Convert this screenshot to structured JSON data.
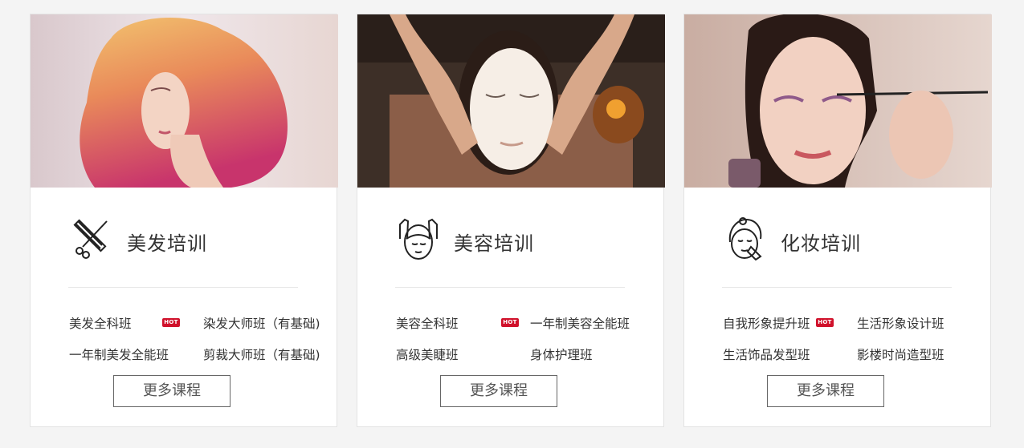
{
  "cards": [
    {
      "title": "美发培训",
      "icon": "scissors-comb-icon",
      "courses": [
        "美发全科班",
        "染发大师班（有基础)",
        "一年制美发全能班",
        "剪裁大师班（有基础)"
      ],
      "hot_badge": "HOT",
      "more_label": "更多课程"
    },
    {
      "title": "美容培训",
      "icon": "face-massage-icon",
      "courses": [
        "美容全科班",
        "一年制美容全能班",
        "高级美睫班",
        "身体护理班"
      ],
      "hot_badge": "HOT",
      "more_label": "更多课程"
    },
    {
      "title": "化妆培训",
      "icon": "makeup-face-icon",
      "courses": [
        "自我形象提升班",
        "生活形象设计班",
        "生活饰品发型班",
        "影楼时尚造型班"
      ],
      "hot_badge": "HOT",
      "more_label": "更多课程"
    }
  ],
  "colors": {
    "hot_badge": "#d0112b",
    "page_bg": "#f4f4f4",
    "card_bg": "#ffffff"
  }
}
